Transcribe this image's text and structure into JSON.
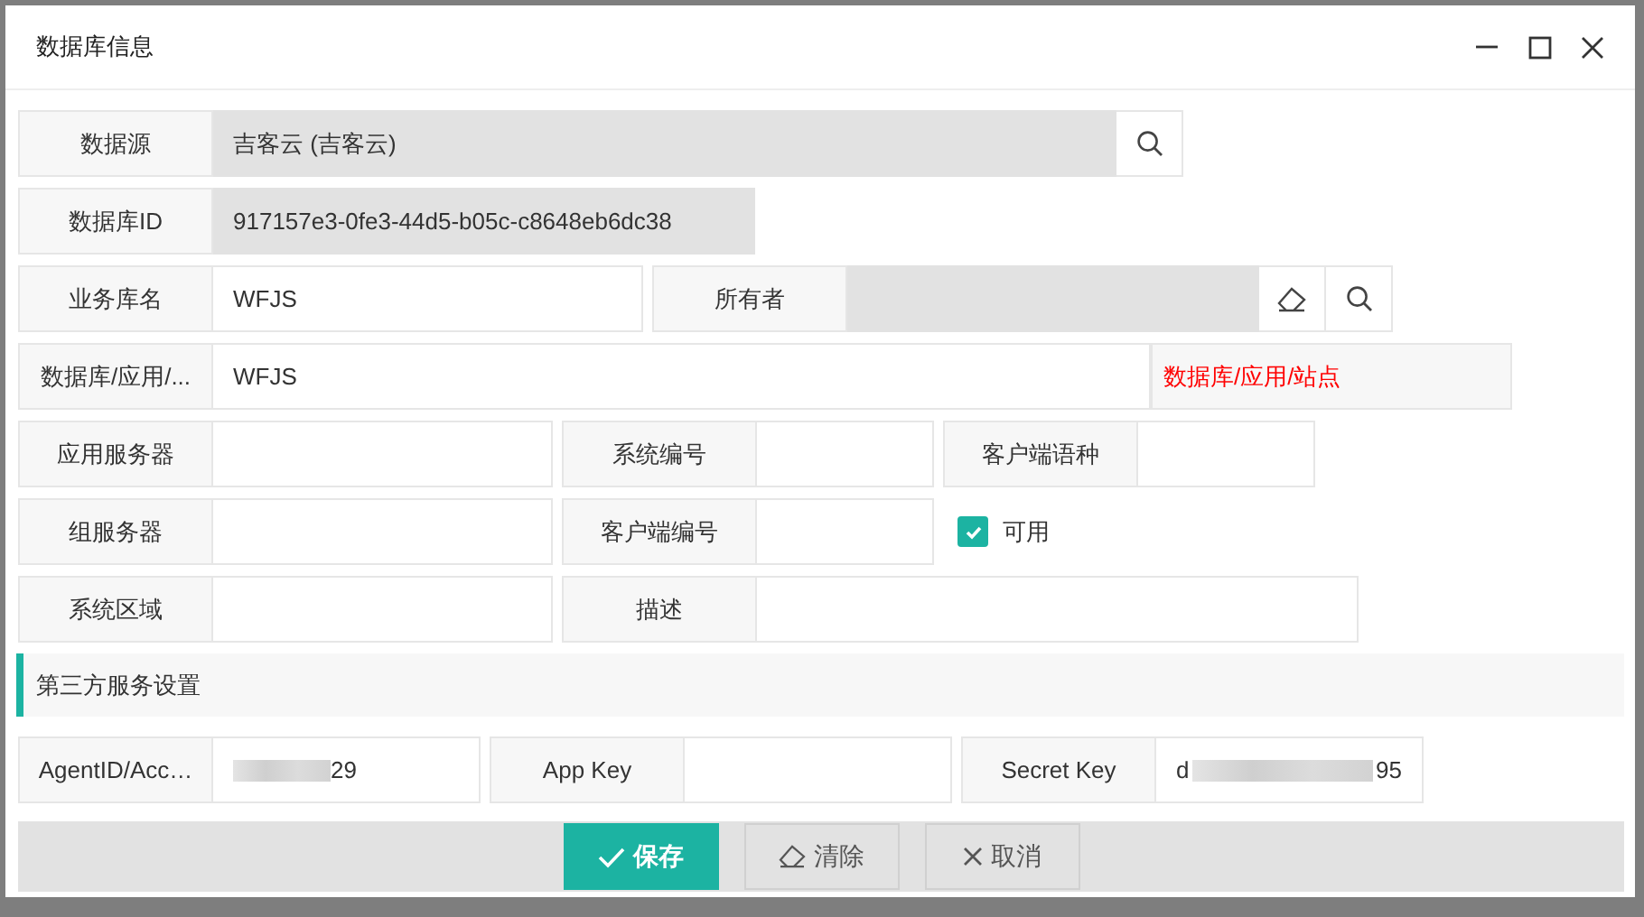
{
  "window": {
    "title": "数据库信息"
  },
  "rows": [
    [
      {
        "kind": "field",
        "label": "数据源",
        "value": "吉客云 (吉客云)",
        "readonly": true,
        "buttons": [
          {
            "kind": "search"
          }
        ]
      }
    ],
    [
      {
        "kind": "field",
        "label": "数据库ID",
        "value": "917157e3-0fe3-44d5-b05c-c8648eb6dc38",
        "readonly": true
      }
    ],
    [
      {
        "kind": "field",
        "label": "业务库名",
        "value": "WFJS",
        "readonly": false
      },
      {
        "kind": "field",
        "label": "所有者",
        "readonly": true,
        "buttons": [
          {
            "kind": "clear"
          },
          {
            "kind": "search"
          }
        ]
      }
    ],
    [
      {
        "kind": "field",
        "label": "数据库/应用/...",
        "value": "WFJS",
        "readonly": false
      },
      {
        "kind": "note",
        "text": "数据库/应用/站点"
      }
    ],
    [
      {
        "kind": "field",
        "label": "应用服务器",
        "readonly": false
      },
      {
        "kind": "field",
        "label": "系统编号",
        "readonly": false
      },
      {
        "kind": "field",
        "label": "客户端语种",
        "readonly": false
      }
    ],
    [
      {
        "kind": "field",
        "label": "组服务器",
        "readonly": false
      },
      {
        "kind": "field",
        "label": "客户端编号",
        "readonly": false
      },
      {
        "kind": "checkbox",
        "label": "可用",
        "checked": true
      }
    ],
    [
      {
        "kind": "field",
        "label": "系统区域",
        "readonly": false
      },
      {
        "kind": "field",
        "label": "描述",
        "readonly": false
      }
    ]
  ],
  "section": {
    "title": "第三方服务设置"
  },
  "service_rows": [
    [
      {
        "kind": "masked",
        "label": "AgentID/Acc…",
        "value_end": "29",
        "readonly": false
      },
      {
        "kind": "field",
        "label": "App Key",
        "readonly": false
      },
      {
        "kind": "masked",
        "label": "Secret Key",
        "value_start": "d",
        "value_end": "95",
        "readonly": false
      }
    ]
  ],
  "footer": {
    "buttons": [
      {
        "kind": "save",
        "label": "保存"
      },
      {
        "kind": "clear",
        "label": "清除"
      },
      {
        "kind": "cancel",
        "label": "取消"
      }
    ]
  }
}
